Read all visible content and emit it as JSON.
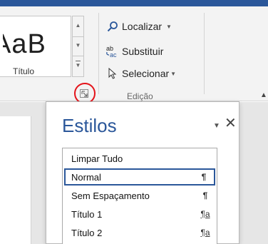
{
  "gallery": {
    "sample_text": "AaB",
    "style_label": "Título"
  },
  "editing_group": {
    "find_label": "Localizar",
    "replace_label": "Substituir",
    "replace_icon_text": "ab→ac",
    "select_label": "Selecionar",
    "group_name": "Edição"
  },
  "styles_pane": {
    "title": "Estilos",
    "items": [
      {
        "label": "Limpar Tudo",
        "mark": "",
        "selected": false
      },
      {
        "label": "Normal",
        "mark": "¶",
        "selected": true
      },
      {
        "label": "Sem Espaçamento",
        "mark": "¶",
        "selected": false
      },
      {
        "label": "Título 1",
        "mark": "¶a",
        "selected": false
      },
      {
        "label": "Título 2",
        "mark": "¶a",
        "selected": false
      }
    ]
  },
  "colors": {
    "accent": "#2b579a",
    "highlight": "#e4141b"
  }
}
